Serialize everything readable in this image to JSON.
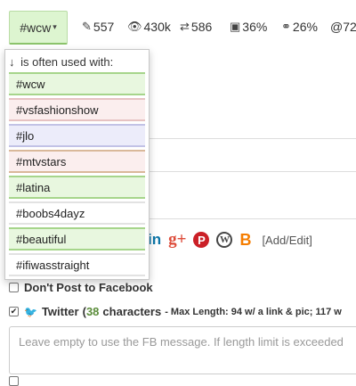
{
  "topbar": {
    "tag_label": "#wcw",
    "caret": "▾",
    "stats": [
      {
        "icon": "pencil-icon",
        "glyph": "✎",
        "value": "557"
      },
      {
        "icon": "eye-icon",
        "glyph": "👁",
        "value": "430k"
      },
      {
        "icon": "retweet-icon",
        "glyph": "⇄",
        "value": "586"
      },
      {
        "icon": "image-icon",
        "glyph": "▣",
        "value": "36%"
      },
      {
        "icon": "link-icon",
        "glyph": "⚭",
        "value": "26%"
      },
      {
        "icon": "mention-icon",
        "glyph": "",
        "value": "@72"
      }
    ]
  },
  "dropdown": {
    "arrow": "↓",
    "header": "is often used with:",
    "items": [
      {
        "label": "#wcw",
        "bg": "#e8f7df",
        "border": "#a6d58b"
      },
      {
        "label": "#vsfashionshow",
        "bg": "#fbeeee",
        "border": "#e6c2c2"
      },
      {
        "label": "#jlo",
        "bg": "#ececfa",
        "border": "#c2c2e6"
      },
      {
        "label": "#mtvstars",
        "bg": "#fbeeee",
        "border": "#d9b89a"
      },
      {
        "label": "#latina",
        "bg": "#e8f7df",
        "border": "#a6d58b"
      },
      {
        "label": "#boobs4dayz",
        "bg": "#ffffff",
        "border": "#e2e2e2"
      },
      {
        "label": "#beautiful",
        "bg": "#e8f7df",
        "border": "#a6d58b"
      },
      {
        "label": "#ifiwasstraight",
        "bg": "#ffffff",
        "border": "#e2e2e2"
      }
    ]
  },
  "social": {
    "linkedin": "in",
    "googleplus": "g+",
    "pinterest": "P",
    "wordpress": "W",
    "blogger": "B",
    "add_edit": "[Add/Edit]"
  },
  "facebook": {
    "label": "Don't Post to Facebook"
  },
  "twitter": {
    "label": "Twitter",
    "open_paren": "(",
    "count": "38",
    "count_suffix": "characters",
    "max_length": "- Max Length: 94 w/ a link & pic; 117 w",
    "placeholder": "Leave empty to use the FB message. If length limit is exceeded"
  }
}
